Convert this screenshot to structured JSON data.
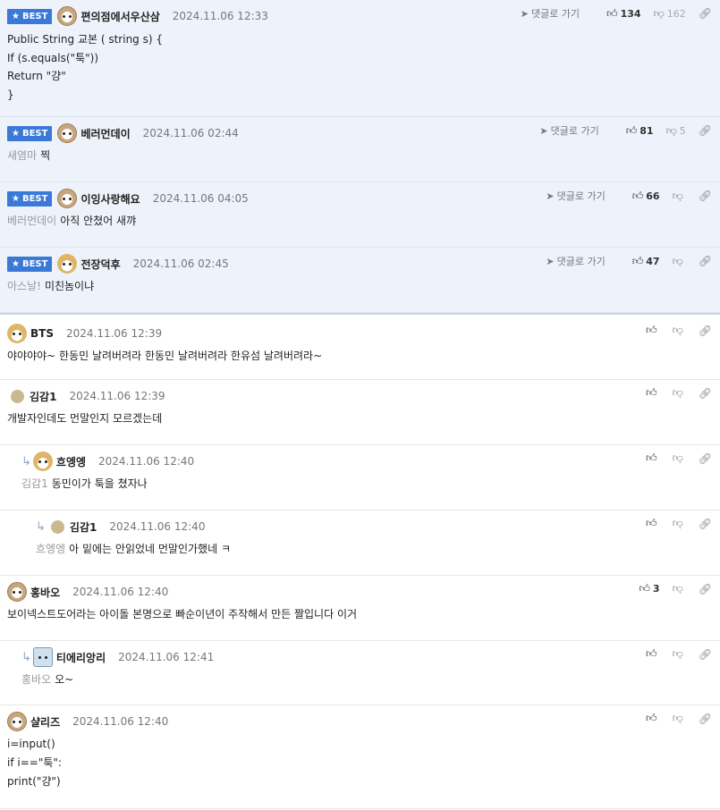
{
  "best_label": "BEST",
  "goto_label": "댓글로 가기",
  "best": [
    {
      "nick": "편의점에서우산삼",
      "date": "2024.11.06 12:33",
      "up": "134",
      "down": "162",
      "lines": [
        "Public String 교본 ( string s) {",
        "If (s.equals(\"툭\"))",
        "Return \"걍\"",
        "}"
      ]
    },
    {
      "nick": "베러먼데이",
      "date": "2024.11.06 02:44",
      "up": "81",
      "down": "5",
      "mention": "새염마",
      "text": "찍"
    },
    {
      "nick": "이잉사랑해요",
      "date": "2024.11.06 04:05",
      "up": "66",
      "down": "",
      "mention": "베러먼데이",
      "text": "아직 안쳤어 새꺄"
    },
    {
      "nick": "전장덕후",
      "date": "2024.11.06 02:45",
      "up": "47",
      "down": "",
      "mention": "아스날!",
      "text": "미친놈이냐"
    }
  ],
  "comments": [
    {
      "nick": "BTS",
      "date": "2024.11.06 12:39",
      "up": "",
      "text": "야야야야~ 한동민 날려버려라 한동민 날려버려라 한유섬 날려버려라~"
    },
    {
      "nick": "김감1",
      "date": "2024.11.06 12:39",
      "up": "",
      "text": "개발자인데도 먼말인지 모르겠는데"
    },
    {
      "nick": "흐엥엥",
      "date": "2024.11.06 12:40",
      "up": "",
      "mention": "김감1",
      "text": "동민이가 툭을 쳤자나"
    },
    {
      "nick": "김감1",
      "date": "2024.11.06 12:40",
      "up": "",
      "mention": "흐엥엥",
      "text": "아 밑에는 안읽었네 먼말인가했네 ㅋ"
    },
    {
      "nick": "홍바오",
      "date": "2024.11.06 12:40",
      "up": "3",
      "text": "보이넥스트도어라는 아이돌 본명으로 빠순이년이 주작해서 만든 짤입니다 이거"
    },
    {
      "nick": "티에리앙리",
      "date": "2024.11.06 12:41",
      "up": "",
      "mention": "홍바오",
      "text": "오~"
    },
    {
      "nick": "샬리즈",
      "date": "2024.11.06 12:40",
      "up": "",
      "lines": [
        "i=input()",
        "if i==\"툭\":",
        "print(\"걍\")"
      ]
    }
  ]
}
